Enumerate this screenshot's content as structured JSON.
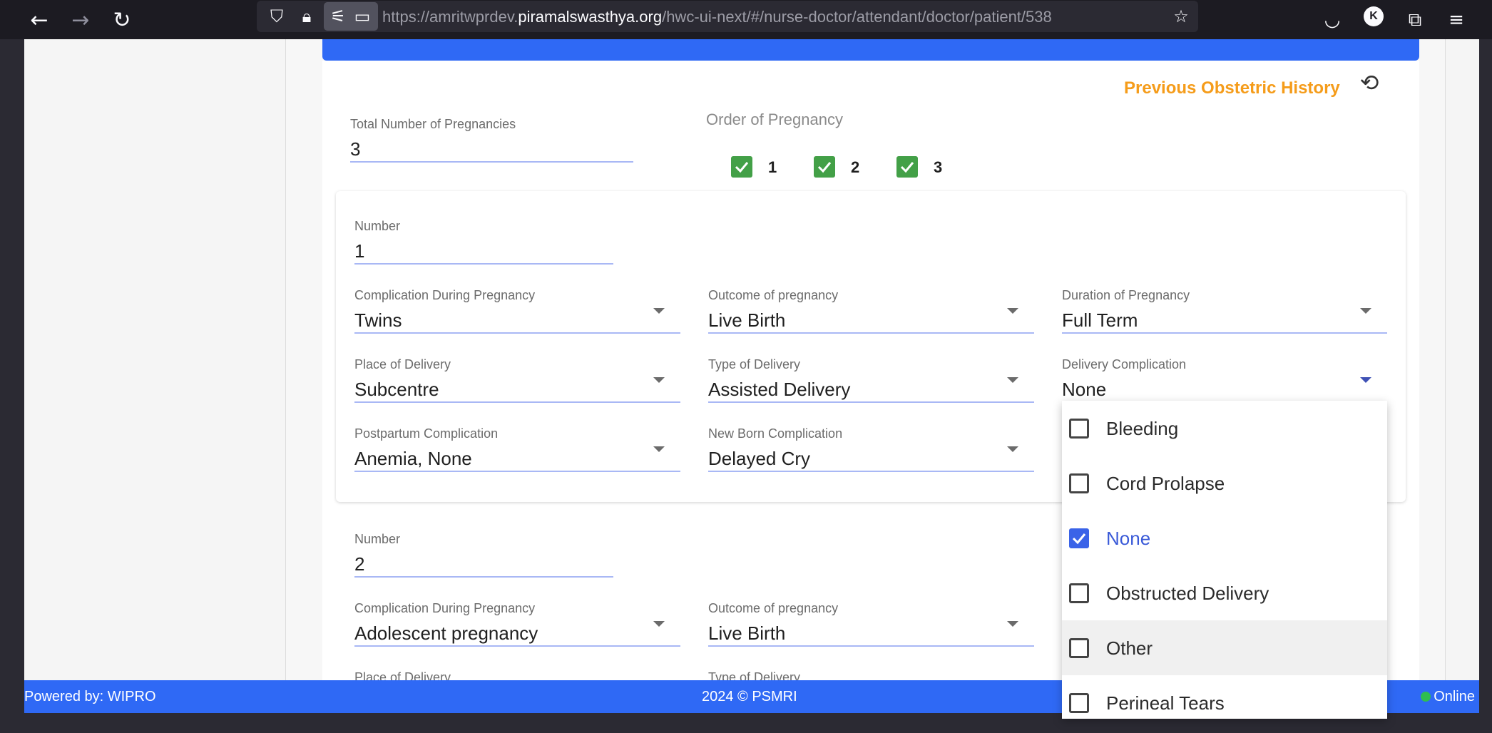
{
  "browser": {
    "url_prefix": "https://amritwprdev.",
    "url_domain": "piramalswasthya.org",
    "url_path": "/hwc-ui-next/#/nurse-doctor/attendant/doctor/patient/538",
    "avatar_letter": "K"
  },
  "header": {
    "prev_history": "Previous Obstetric History"
  },
  "pregnancy": {
    "total_label": "Total Number of Pregnancies",
    "total_value": "3",
    "order_label": "Order of Pregnancy",
    "order_items": [
      "1",
      "2",
      "3"
    ]
  },
  "record1": {
    "number_label": "Number",
    "number_value": "1",
    "complication_label": "Complication During Pregnancy",
    "complication_value": "Twins",
    "outcome_label": "Outcome of pregnancy",
    "outcome_value": "Live Birth",
    "duration_label": "Duration of Pregnancy",
    "duration_value": "Full Term",
    "place_label": "Place of Delivery",
    "place_value": "Subcentre",
    "type_label": "Type of Delivery",
    "type_value": "Assisted Delivery",
    "delivery_comp_label": "Delivery Complication",
    "delivery_comp_value": "None",
    "postpartum_label": "Postpartum Complication",
    "postpartum_value": "Anemia, None",
    "newborn_label": "New Born Complication",
    "newborn_value": "Delayed Cry"
  },
  "record2": {
    "number_label": "Number",
    "number_value": "2",
    "complication_label": "Complication During Pregnancy",
    "complication_value": "Adolescent pregnancy",
    "outcome_label": "Outcome of pregnancy",
    "outcome_value": "Live Birth",
    "place_label": "Place of Delivery",
    "type_label": "Type of Delivery"
  },
  "dropdown": {
    "options": [
      "Bleeding",
      "Cord Prolapse",
      "None",
      "Obstructed Delivery",
      "Other",
      "Perineal Tears"
    ],
    "selected": "None"
  },
  "footer": {
    "powered": "Powered by: WIPRO",
    "copyright": "2024 © PSMRI",
    "status": "Online"
  },
  "colors": {
    "accent": "#2f69f5",
    "history": "#f59c1a",
    "checkbox_green": "#43a047",
    "checkbox_blue": "#3a63e8"
  }
}
